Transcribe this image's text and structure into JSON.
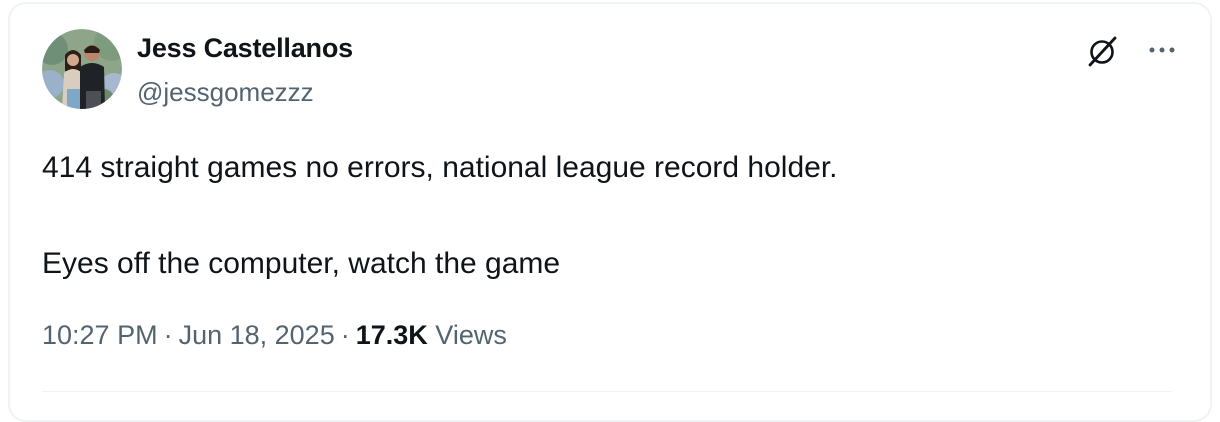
{
  "tweet": {
    "author_name": "Jess Castellanos",
    "author_handle": "@jessgomezzz",
    "text_line_1": "414 straight games no errors, national league record holder.",
    "text_line_2": "Eyes off the computer, watch the game",
    "time": "10:27 PM",
    "date": "Jun 18, 2025",
    "separator": "·",
    "views_count": "17.3K",
    "views_label": "Views"
  },
  "icons": {
    "grok": "grok-icon",
    "more": "more-icon"
  },
  "colors": {
    "text_primary": "#0f1419",
    "text_secondary": "#536471",
    "border": "#eff3f4"
  }
}
